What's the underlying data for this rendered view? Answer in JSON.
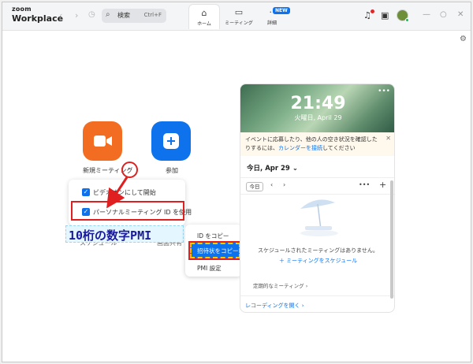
{
  "app": {
    "logo_top": "zoom",
    "logo_bottom": "Workplace"
  },
  "search": {
    "placeholder": "検索",
    "shortcut": "Ctrl+F"
  },
  "tabs": [
    {
      "label": "ホーム",
      "active": true
    },
    {
      "label": "ミーティング",
      "active": false
    },
    {
      "label": "詳細",
      "active": false,
      "badge": "NEW"
    }
  ],
  "actions": {
    "new_meeting": "新規ミーティング",
    "join": "参加"
  },
  "meeting_dropdown": {
    "items": [
      {
        "label": "ビデオオンにして開始",
        "checked": true
      },
      {
        "label": "パーソナルミーティング ID を使用",
        "checked": true
      }
    ]
  },
  "annotation": {
    "pmi_banner": "10桁の数字PMI"
  },
  "bottom_actions": {
    "schedule": "スケジュール",
    "share": "画面共有"
  },
  "pmi_menu": {
    "items": [
      "ID をコピー",
      "招待状をコピー",
      "PMI 設定"
    ],
    "highlighted_index": 1
  },
  "calendar_panel": {
    "time": "21:49",
    "date": "火曜日, April 29",
    "notice_text": "イベントに応募したり、他の人の空き状況を確認したりするには、",
    "notice_link": "カレンダーを接続",
    "notice_end": "してください",
    "day_header": "今日, Apr 29",
    "today_button": "今日",
    "empty_message": "スケジュールされたミーティングはありません。",
    "schedule_link": "ミーティングをスケジュール",
    "recurring": "定期的なミーティング",
    "recordings": "レコーディングを開く"
  },
  "colors": {
    "accent": "#0e72ed",
    "orange": "#f26d21",
    "annotation_red": "#e02020",
    "annotation_banner_text": "#1a1a9a"
  },
  "icons": [
    "home-icon",
    "video-camera-icon",
    "more-icon",
    "bell-icon",
    "gear-icon",
    "plus-icon",
    "search-icon",
    "clock-icon"
  ]
}
